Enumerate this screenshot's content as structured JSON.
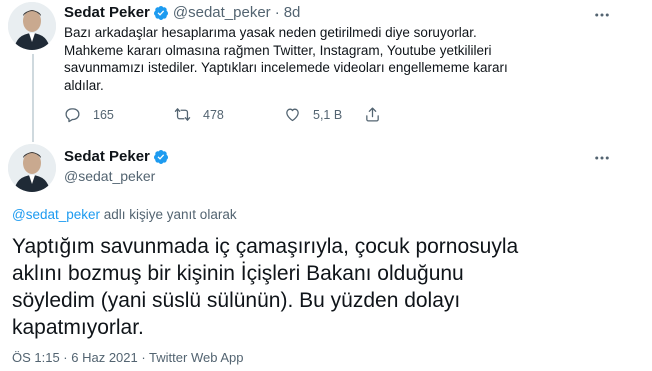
{
  "tweet1": {
    "author_name": "Sedat Peker",
    "handle": "@sedat_peker",
    "separator": "·",
    "time": "8d",
    "text_lines": [
      "Bazı arkadaşlar hesaplarıma yasak neden getirilmedi diye soruyorlar.",
      "Mahkeme kararı olmasına rağmen Twitter, Instagram, Youtube yetkilileri",
      "savunmamızı istediler. Yaptıkları incelemede videoları engellememe kararı",
      "aldılar."
    ],
    "actions": {
      "reply_count": "165",
      "retweet_count": "478",
      "like_count": "5,1 B"
    }
  },
  "tweet2": {
    "author_name": "Sedat Peker",
    "handle": "@sedat_peker",
    "reply_to_mention": "@sedat_peker",
    "reply_to_suffix": " adlı kişiye yanıt olarak",
    "text_lines": [
      "Yaptığım savunmada iç çamaşırıyla, çocuk pornosuyla",
      "aklını bozmuş bir kişinin İçişleri Bakanı olduğunu",
      "söyledim (yani süslü sülünün). Bu yüzden dolayı",
      "kapatmıyorlar."
    ],
    "meta": "ÖS 1:15 · 6 Haz 2021 · Twitter Web App"
  },
  "icons": {
    "verified": "verified-badge-icon",
    "more": "more-options-icon",
    "reply": "reply-icon",
    "retweet": "retweet-icon",
    "like": "heart-icon",
    "share": "share-icon"
  },
  "colors": {
    "verified": "#1d9bf0",
    "mention": "#1d9bf0",
    "secondary_text": "#536471",
    "primary_text": "#0f1419"
  }
}
